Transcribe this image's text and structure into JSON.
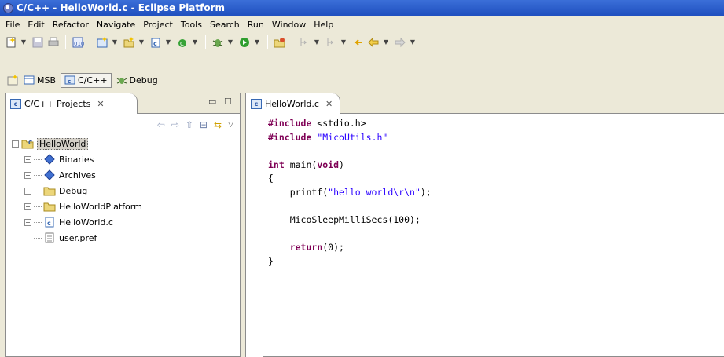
{
  "window": {
    "title": "C/C++ - HelloWorld.c - Eclipse Platform"
  },
  "menu": [
    "File",
    "Edit",
    "Refactor",
    "Navigate",
    "Project",
    "Tools",
    "Search",
    "Run",
    "Window",
    "Help"
  ],
  "perspectives": [
    {
      "label": "MSB",
      "active": false
    },
    {
      "label": "C/C++",
      "active": true
    },
    {
      "label": "Debug",
      "active": false
    }
  ],
  "project_view": {
    "tab_label": "C/C++ Projects",
    "close_glyph": "✕",
    "tree": {
      "root": "HelloWorld",
      "children": [
        "Binaries",
        "Archives",
        "Debug",
        "HelloWorldPlatform",
        "HelloWorld.c",
        "user.pref"
      ]
    }
  },
  "editor": {
    "tab_label": "HelloWorld.c",
    "close_glyph": "✕",
    "lines": [
      [
        {
          "t": "#include",
          "c": "kw"
        },
        {
          "t": " <stdio.h>"
        }
      ],
      [
        {
          "t": "#include",
          "c": "kw"
        },
        {
          "t": " "
        },
        {
          "t": "\"MicoUtils.h\"",
          "c": "str"
        }
      ],
      [],
      [
        {
          "t": "int",
          "c": "kw"
        },
        {
          "t": " main("
        },
        {
          "t": "void",
          "c": "kw"
        },
        {
          "t": ")"
        }
      ],
      [
        {
          "t": "{"
        }
      ],
      [
        {
          "t": "    printf("
        },
        {
          "t": "\"hello world\\r\\n\"",
          "c": "str"
        },
        {
          "t": ");"
        }
      ],
      [],
      [
        {
          "t": "    MicoSleepMilliSecs(100);"
        }
      ],
      [],
      [
        {
          "t": "    "
        },
        {
          "t": "return",
          "c": "kw"
        },
        {
          "t": "(0);"
        }
      ],
      [
        {
          "t": "}"
        }
      ]
    ]
  },
  "colors": {
    "titlebar": "#1f4fbf",
    "keyword": "#7f0055",
    "string": "#2a00ff"
  }
}
